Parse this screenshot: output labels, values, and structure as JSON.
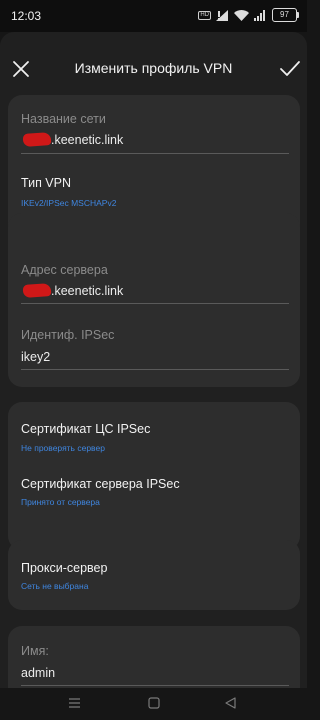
{
  "status": {
    "time": "12:03",
    "hd": "HD",
    "battery": "97"
  },
  "toolbar": {
    "title": "Изменить профиль VPN",
    "close_icon": "close-icon",
    "confirm_icon": "checkmark-icon"
  },
  "network_name": {
    "label": "Название сети",
    "value_suffix": ".keenetic.link"
  },
  "vpn_type": {
    "label": "Тип VPN",
    "value": "IKEv2/IPSec MSCHAPv2"
  },
  "server_address": {
    "label": "Адрес сервера",
    "value_suffix": ".keenetic.link"
  },
  "ipsec_id": {
    "label": "Идентиф. IPSec",
    "value": "ikey2"
  },
  "ca_cert": {
    "label": "Сертификат ЦС IPSec",
    "value": "Не проверять сервер"
  },
  "server_cert": {
    "label": "Сертификат сервера IPSec",
    "value": "Принято от сервера"
  },
  "proxy": {
    "label": "Прокси-сервер",
    "value": "Сеть не выбрана"
  },
  "username": {
    "label": "Имя:",
    "value": "admin"
  },
  "colors": {
    "accent": "#3f86e0",
    "card": "#2d2d2d",
    "sheet": "#202020",
    "redaction": "#d01818"
  },
  "nav": {
    "menu_icon": "menu-icon",
    "home_icon": "home-icon",
    "back_icon": "back-icon"
  }
}
